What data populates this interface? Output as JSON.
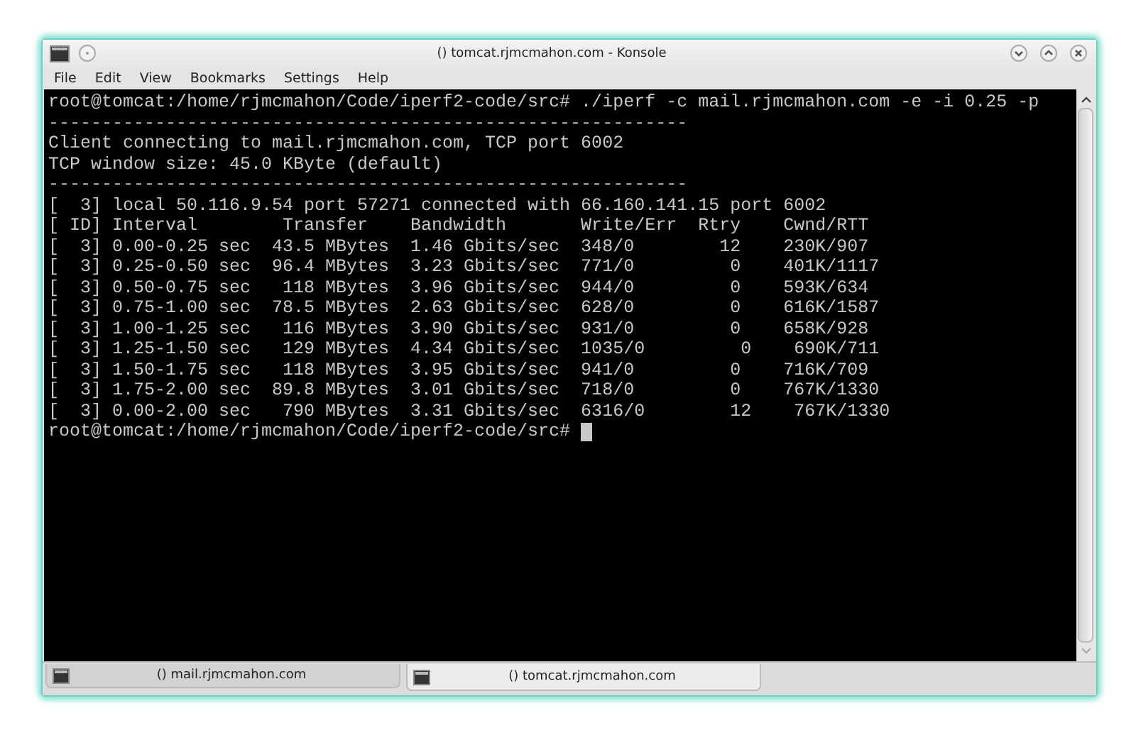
{
  "window": {
    "title": "() tomcat.rjmcmahon.com - Konsole"
  },
  "menu": [
    "File",
    "Edit",
    "View",
    "Bookmarks",
    "Settings",
    "Help"
  ],
  "terminal": {
    "lines": [
      "root@tomcat:/home/rjmcmahon/Code/iperf2-code/src# ./iperf -c mail.rjmcmahon.com -e -i 0.25 -p",
      "------------------------------------------------------------",
      "Client connecting to mail.rjmcmahon.com, TCP port 6002",
      "TCP window size: 45.0 KByte (default)",
      "------------------------------------------------------------",
      "[  3] local 50.116.9.54 port 57271 connected with 66.160.141.15 port 6002",
      "[ ID] Interval        Transfer    Bandwidth       Write/Err  Rtry    Cwnd/RTT",
      "[  3] 0.00-0.25 sec  43.5 MBytes  1.46 Gbits/sec  348/0        12    230K/907",
      "[  3] 0.25-0.50 sec  96.4 MBytes  3.23 Gbits/sec  771/0         0    401K/1117",
      "[  3] 0.50-0.75 sec   118 MBytes  3.96 Gbits/sec  944/0         0    593K/634",
      "[  3] 0.75-1.00 sec  78.5 MBytes  2.63 Gbits/sec  628/0         0    616K/1587",
      "[  3] 1.00-1.25 sec   116 MBytes  3.90 Gbits/sec  931/0         0    658K/928",
      "[  3] 1.25-1.50 sec   129 MBytes  4.34 Gbits/sec  1035/0         0    690K/711",
      "[  3] 1.50-1.75 sec   118 MBytes  3.95 Gbits/sec  941/0         0    716K/709",
      "[  3] 1.75-2.00 sec  89.8 MBytes  3.01 Gbits/sec  718/0         0    767K/1330",
      "[  3] 0.00-2.00 sec   790 MBytes  3.31 Gbits/sec  6316/0        12    767K/1330"
    ],
    "prompt": "root@tomcat:/home/rjmcmahon/Code/iperf2-code/src#"
  },
  "tabs": [
    {
      "label": "() mail.rjmcmahon.com",
      "selected": false
    },
    {
      "label": "() tomcat.rjmcmahon.com",
      "selected": true
    }
  ]
}
